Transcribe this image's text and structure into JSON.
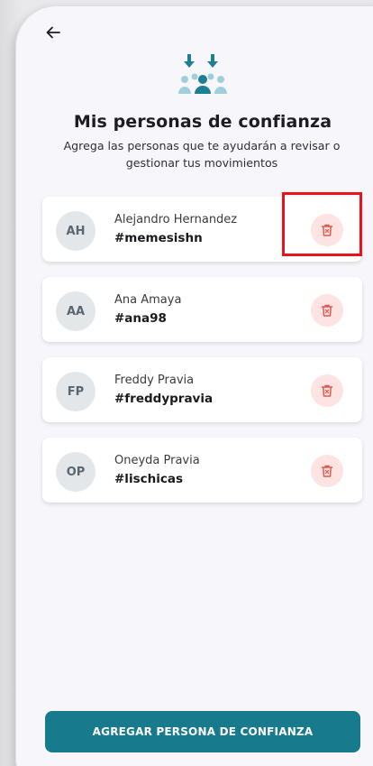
{
  "nav": {
    "back_icon": "arrow-left-icon"
  },
  "header": {
    "icon": "people-download-icon",
    "title": "Mis personas de confianza",
    "subtitle": "Agrega las personas que te ayudarán a revisar o gestionar tus movimientos"
  },
  "contacts": [
    {
      "initials": "AH",
      "name": "Alejandro Hernandez",
      "handle": "#memesishn",
      "delete_icon": "trash-icon"
    },
    {
      "initials": "AA",
      "name": "Ana Amaya",
      "handle": "#ana98",
      "delete_icon": "trash-icon"
    },
    {
      "initials": "FP",
      "name": "Freddy Pravia",
      "handle": "#freddypravia",
      "delete_icon": "trash-icon"
    },
    {
      "initials": "OP",
      "name": "Oneyda Pravia",
      "handle": "#lischicas",
      "delete_icon": "trash-icon"
    }
  ],
  "footer": {
    "add_button_label": "AGREGAR PERSONA DE CONFIANZA"
  },
  "colors": {
    "accent": "#177b8d",
    "delete_bg": "#fde3e1",
    "delete_icon": "#e05a52",
    "highlight": "#e8141b",
    "people_icon": "#1d7f93"
  }
}
